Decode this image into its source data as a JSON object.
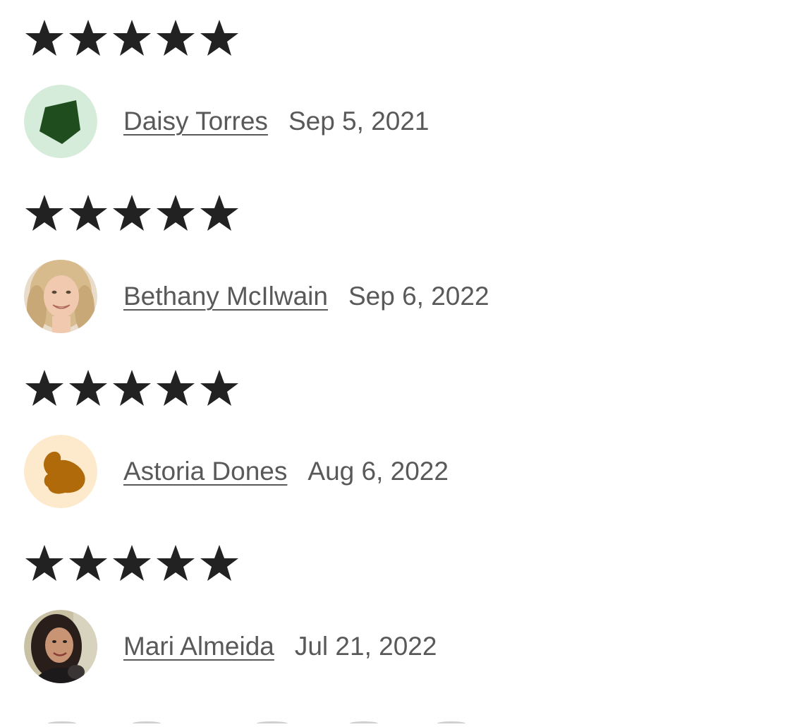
{
  "reviews": [
    {
      "rating": 5,
      "reviewer": "Daisy Torres",
      "date": "Sep 5, 2021",
      "avatar": {
        "kind": "shape",
        "shape": "pentagon",
        "background": "#d4ecd9",
        "foreground": "#1f4d1e"
      }
    },
    {
      "rating": 5,
      "reviewer": "Bethany McIlwain",
      "date": "Sep 6, 2022",
      "avatar": {
        "kind": "photo",
        "description_icon": "user-photo"
      }
    },
    {
      "rating": 5,
      "reviewer": "Astoria Dones",
      "date": "Aug 6, 2022",
      "avatar": {
        "kind": "shape",
        "shape": "blob",
        "background": "#fde9cc",
        "foreground": "#b06a0a"
      }
    },
    {
      "rating": 5,
      "reviewer": "Mari Almeida",
      "date": "Jul 21, 2022",
      "avatar": {
        "kind": "photo",
        "description_icon": "user-photo"
      }
    }
  ],
  "colors": {
    "star": "#222222",
    "text": "#595959"
  }
}
